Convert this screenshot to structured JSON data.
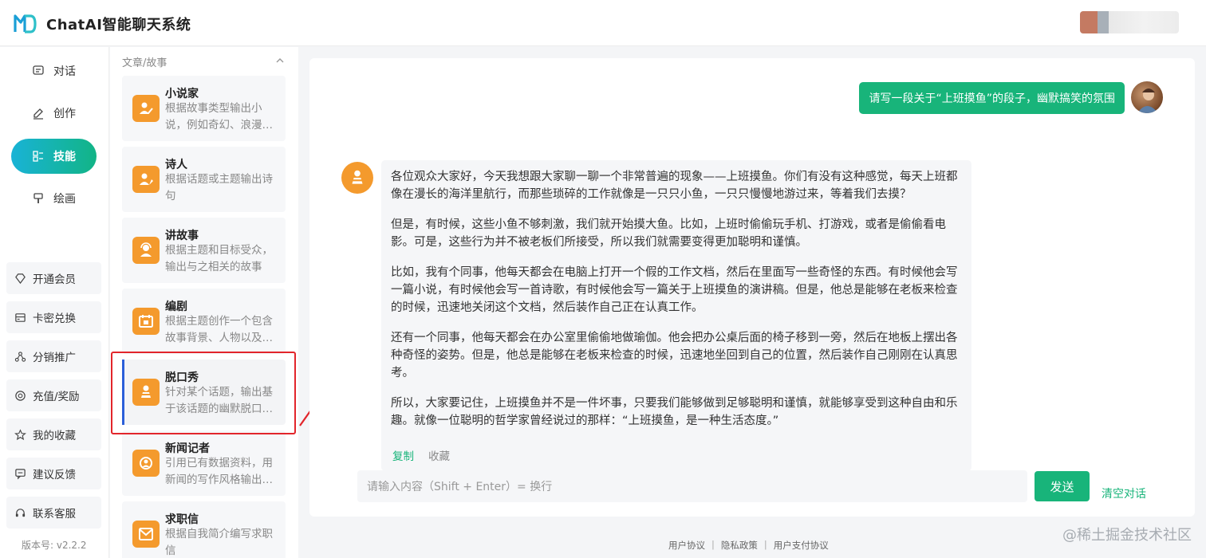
{
  "header": {
    "title": "ChatAI智能聊天系统",
    "brand_color": "#1a9fd6"
  },
  "nav": {
    "items": [
      {
        "label": "对话",
        "icon": "chat-bubble-icon"
      },
      {
        "label": "创作",
        "icon": "pencil-icon"
      },
      {
        "label": "技能",
        "icon": "skills-list-icon",
        "active": true
      },
      {
        "label": "绘画",
        "icon": "brush-icon"
      }
    ],
    "menu": [
      {
        "label": "开通会员",
        "icon": "diamond-icon"
      },
      {
        "label": "卡密兑换",
        "icon": "card-icon"
      },
      {
        "label": "分销推广",
        "icon": "share-icon"
      },
      {
        "label": "充值/奖励",
        "icon": "coin-icon"
      },
      {
        "label": "我的收藏",
        "icon": "star-icon"
      },
      {
        "label": "建议反馈",
        "icon": "feedback-icon"
      },
      {
        "label": "联系客服",
        "icon": "headset-icon"
      }
    ],
    "version": "版本号: v2.2.2",
    "active_color": "#15b3a8"
  },
  "skills": {
    "category": "文章/故事",
    "cards": [
      {
        "name": "小说家",
        "desc": "根据故事类型输出小说，例如奇幻、浪漫…"
      },
      {
        "name": "诗人",
        "desc": "根据话题或主题输出诗句"
      },
      {
        "name": "讲故事",
        "desc": "根据主题和目标受众，输出与之相关的故事"
      },
      {
        "name": "编剧",
        "desc": "根据主题创作一个包含故事背景、人物以及…"
      },
      {
        "name": "脱口秀",
        "desc": "针对某个话题，输出基于该话题的幽默脱口…",
        "selected": true
      },
      {
        "name": "新闻记者",
        "desc": "引用已有数据资料，用新闻的写作风格输出…"
      },
      {
        "name": "求职信",
        "desc": "根据自我简介编写求职信"
      }
    ]
  },
  "chat": {
    "user_message": "请写一段关于“上班摸鱼”的段子，幽默搞笑的氛围",
    "answer": [
      "各位观众大家好，今天我想跟大家聊一聊一个非常普遍的现象——上班摸鱼。你们有没有这种感觉，每天上班都像在漫长的海洋里航行，而那些琐碎的工作就像是一只只小鱼，一只只慢慢地游过来，等着我们去摸？",
      "但是，有时候，这些小鱼不够刺激，我们就开始摸大鱼。比如，上班时偷偷玩手机、打游戏，或者是偷偷看电影。可是，这些行为并不被老板们所接受，所以我们就需要变得更加聪明和谨慎。",
      "比如，我有个同事，他每天都会在电脑上打开一个假的工作文档，然后在里面写一些奇怪的东西。有时候他会写一篇小说，有时候他会写一首诗歌，有时候他会写一篇关于上班摸鱼的演讲稿。但是，他总是能够在老板来检查的时候，迅速地关闭这个文档，然后装作自己正在认真工作。",
      "还有一个同事，他每天都会在办公室里偷偷地做瑜伽。他会把办公桌后面的椅子移到一旁，然后在地板上摆出各种奇怪的姿势。但是，他总是能够在老板来检查的时候，迅速地坐回到自己的位置，然后装作自己刚刚在认真思考。",
      "所以，大家要记住，上班摸鱼并不是一件坏事，只要我们能够做到足够聪明和谨慎，就能够享受到这种自由和乐趣。就像一位聪明的哲学家曾经说过的那样：“上班摸鱼，是一种生活态度。”"
    ],
    "copy_label": "复制",
    "favorite_label": "收藏",
    "input_placeholder": "请输入内容（Shift + Enter）= 换行",
    "send_label": "发送",
    "clear_label": "清空对话",
    "accent_color": "#18b47a"
  },
  "footer": {
    "links": [
      "用户协议",
      "隐私政策",
      "用户支付协议"
    ]
  },
  "watermark": "@稀土掘金技术社区"
}
